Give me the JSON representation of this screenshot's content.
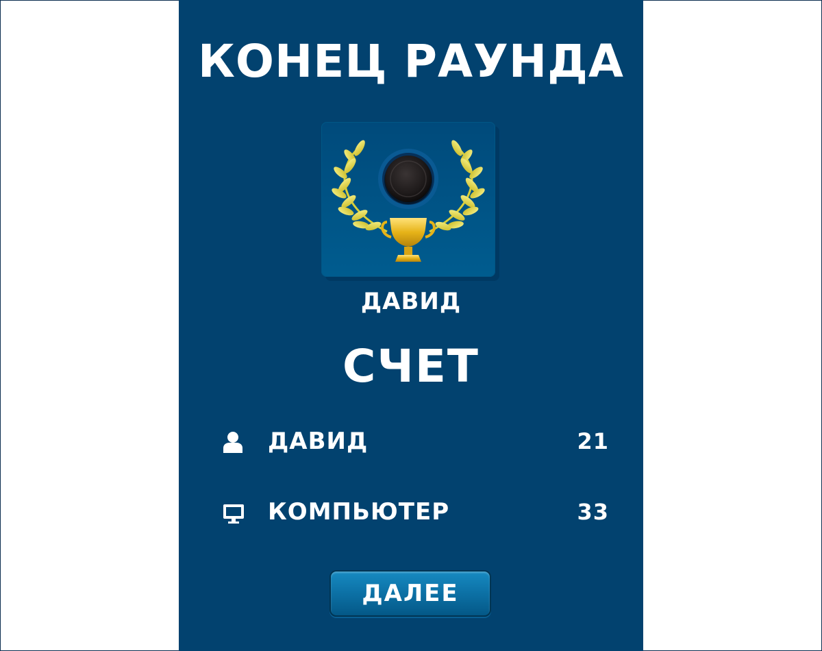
{
  "screen": {
    "title": "КОНЕЦ РАУНДА",
    "score_title": "СЧЕТ"
  },
  "winner": {
    "name": "ДАВИД",
    "icons": [
      "laurel-wreath-icon",
      "black-checker-icon",
      "trophy-icon"
    ]
  },
  "scores": [
    {
      "name": "ДАВИД",
      "score": "21",
      "icon": "user-icon"
    },
    {
      "name": "КОМПЬЮТЕР",
      "score": "33",
      "icon": "computer-monitor-icon"
    }
  ],
  "actions": {
    "next_label": "ДАЛЕЕ"
  },
  "colors": {
    "panel_bg": "#02426f",
    "button_bg": "#0d73a8",
    "laurel_gold": "#e8e04a",
    "trophy_gold": "#e6b318",
    "text": "#ffffff"
  }
}
